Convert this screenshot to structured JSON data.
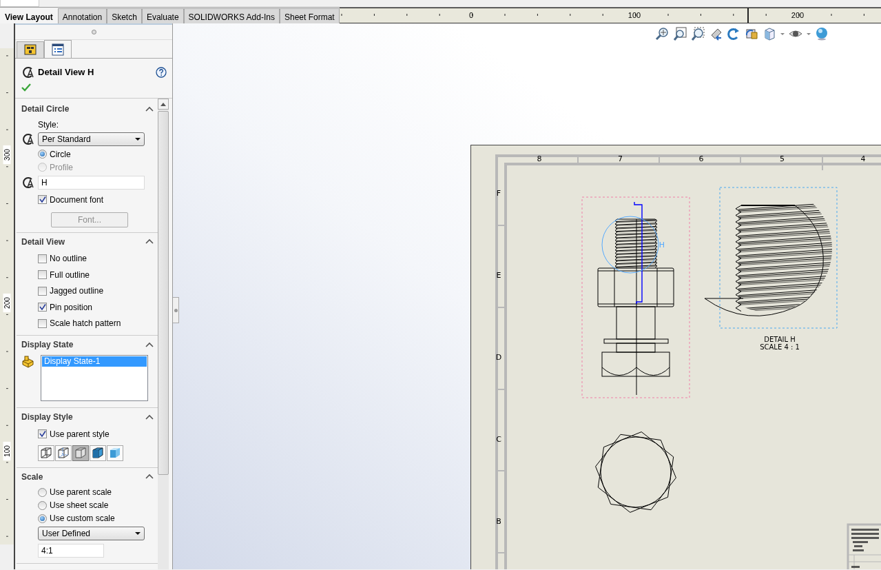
{
  "tabs": [
    {
      "label": "View Layout",
      "selected": true
    },
    {
      "label": "Annotation",
      "selected": false
    },
    {
      "label": "Sketch",
      "selected": false
    },
    {
      "label": "Evaluate",
      "selected": false
    },
    {
      "label": "SOLIDWORKS Add-Ins",
      "selected": false
    },
    {
      "label": "Sheet Format",
      "selected": false
    }
  ],
  "rulers": {
    "horizontal": [
      "0",
      "100",
      "200"
    ],
    "vertical": [
      "300",
      "200",
      "100"
    ]
  },
  "panel": {
    "tabs": [
      {
        "kind": "tree",
        "selected": false
      },
      {
        "kind": "properties",
        "selected": true
      }
    ],
    "title": "Detail View H",
    "sections": [
      {
        "title": "Detail Circle",
        "expanded": true,
        "items": [
          {
            "kind": "label",
            "text": "Style:"
          },
          {
            "kind": "dropdown",
            "value": "Per Standard",
            "icon": true
          },
          {
            "kind": "radio",
            "label": "Circle",
            "checked": true,
            "disabled": false
          },
          {
            "kind": "radio",
            "label": "Profile",
            "checked": false,
            "disabled": true
          },
          {
            "kind": "text-field",
            "value": "H",
            "icon": true
          },
          {
            "kind": "checkbox",
            "label": "Document font",
            "checked": true
          },
          {
            "kind": "button",
            "label": "Font...",
            "disabled": true
          }
        ]
      },
      {
        "title": "Detail View",
        "expanded": true,
        "items": [
          {
            "kind": "checkbox",
            "label": "No outline",
            "checked": false
          },
          {
            "kind": "checkbox",
            "label": "Full outline",
            "checked": false
          },
          {
            "kind": "checkbox",
            "label": "Jagged outline",
            "checked": false
          },
          {
            "kind": "checkbox",
            "label": "Pin position",
            "checked": true
          },
          {
            "kind": "checkbox",
            "label": "Scale hatch pattern",
            "checked": false
          }
        ]
      },
      {
        "title": "Display State",
        "expanded": true,
        "items": [
          {
            "kind": "list",
            "icon": true,
            "entries": [
              {
                "label": "Display State-1",
                "selected": true
              }
            ]
          }
        ]
      },
      {
        "title": "Display Style",
        "expanded": true,
        "items": [
          {
            "kind": "checkbox",
            "label": "Use parent style",
            "checked": true
          },
          {
            "kind": "style-buttons",
            "buttons": [
              {
                "kind": "wireframe",
                "selected": false
              },
              {
                "kind": "hidden-visible",
                "selected": false
              },
              {
                "kind": "hidden-removed",
                "selected": true
              },
              {
                "kind": "shaded-edges",
                "selected": false
              },
              {
                "kind": "shaded",
                "selected": false
              }
            ]
          }
        ]
      },
      {
        "title": "Scale",
        "expanded": true,
        "items": [
          {
            "kind": "radio",
            "label": "Use parent scale",
            "checked": false,
            "disabled": false
          },
          {
            "kind": "radio",
            "label": "Use sheet scale",
            "checked": false,
            "disabled": false
          },
          {
            "kind": "radio",
            "label": "Use custom scale",
            "checked": true,
            "disabled": false
          },
          {
            "kind": "dropdown",
            "value": "User Defined",
            "icon": false
          },
          {
            "kind": "text-field",
            "value": "4:1",
            "icon": false
          }
        ]
      }
    ]
  },
  "sheet": {
    "columns": [
      "8",
      "7",
      "6",
      "5",
      "4"
    ],
    "rows": [
      "F",
      "E",
      "D",
      "C",
      "B"
    ],
    "detail_letter": "H",
    "caption": [
      "DETAIL H",
      "SCALE 4 : 1"
    ]
  }
}
